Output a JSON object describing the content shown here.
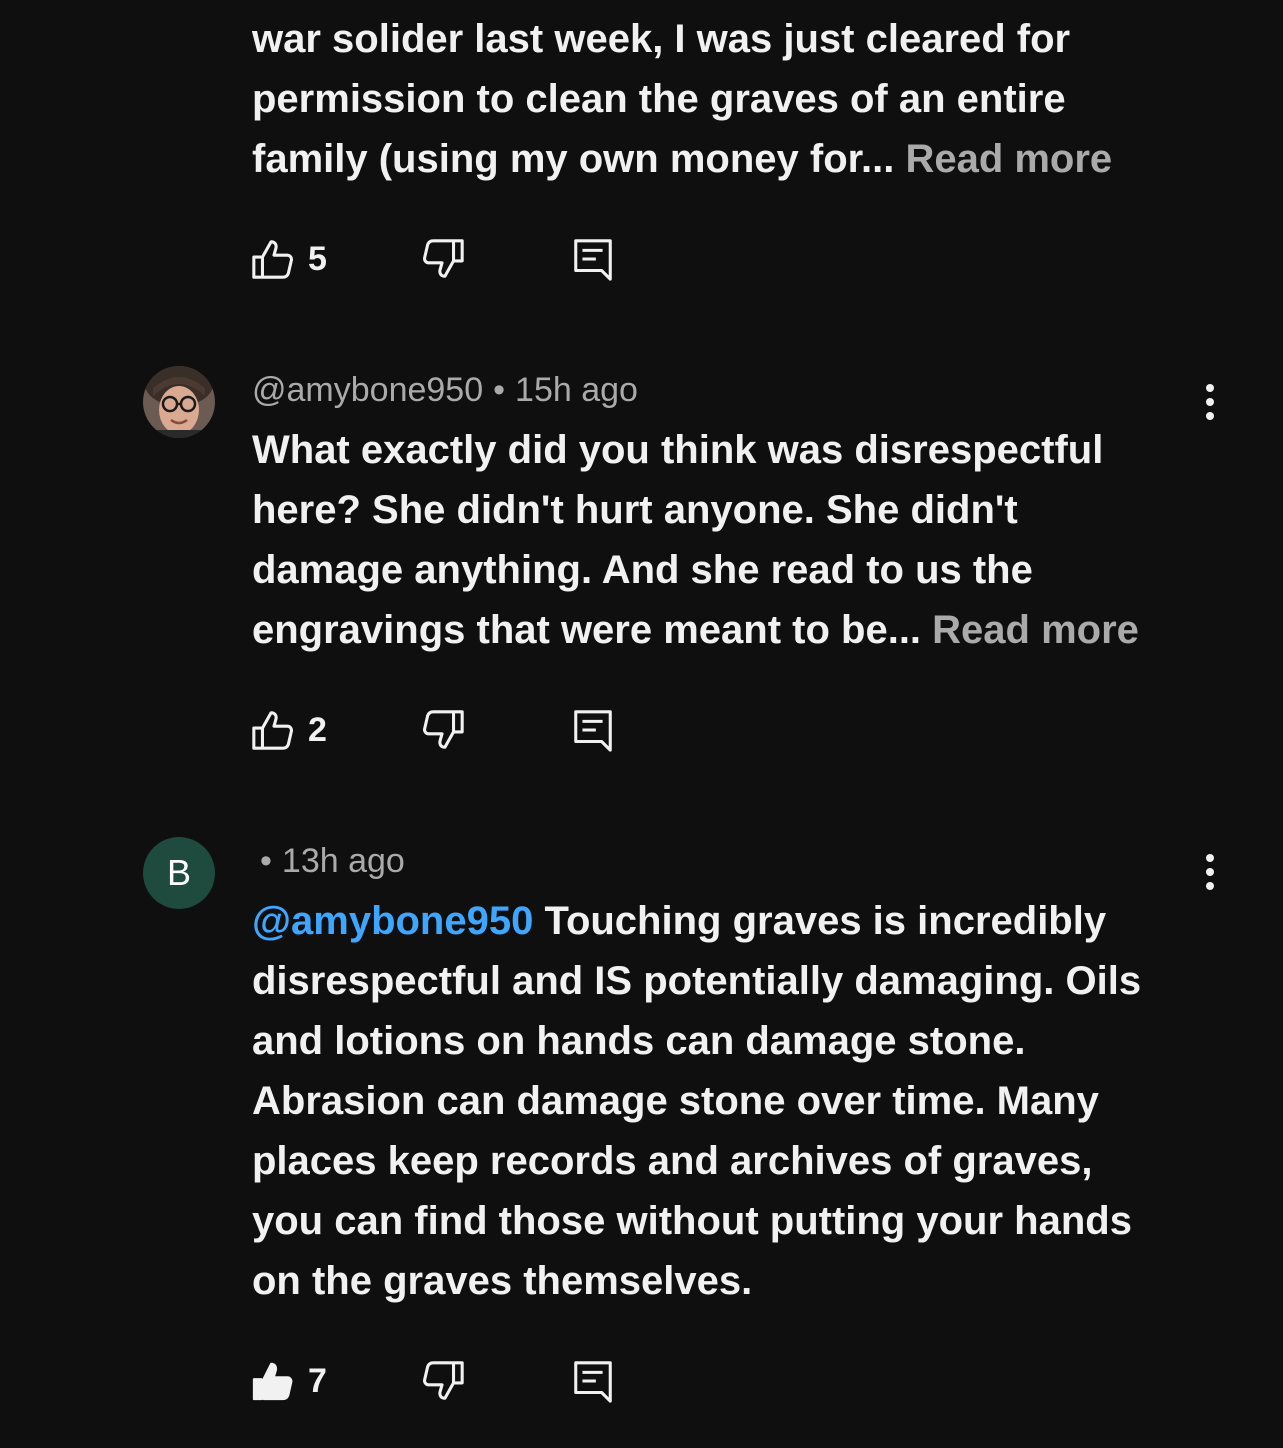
{
  "colors": {
    "background": "#0f0f0f",
    "text": "#f1f1f1",
    "muted": "#aaaaaa",
    "mention": "#3ea6ff",
    "avatar_b_bg": "#1f4a3e"
  },
  "comments": [
    {
      "body_lines": [
        "war solider last week, I was just cleared for",
        "permission to clean the graves of an entire",
        "family (using my own money for... "
      ],
      "read_more": "Read more",
      "likes": "5",
      "liked": false,
      "icons": [
        "thumb-up-icon",
        "thumb-down-icon",
        "reply-icon"
      ]
    },
    {
      "avatar": "photo-avatar",
      "handle": "@amybone950",
      "separator": "•",
      "time": "15h ago",
      "body_lines": [
        "What exactly did you think was disrespectful",
        "here? She didn't hurt anyone. She didn't",
        "damage anything. And she read to us the",
        "engravings that were meant to be... "
      ],
      "read_more": "Read more",
      "likes": "2",
      "liked": false,
      "icons": [
        "more-vert-icon",
        "thumb-up-icon",
        "thumb-down-icon",
        "reply-icon"
      ]
    },
    {
      "avatar_letter": "B",
      "separator": "•",
      "time": "13h ago",
      "mention": "@amybone950",
      "body_first": " Touching graves is incredibly",
      "body_lines": [
        "disrespectful and IS potentially damaging. Oils",
        "and lotions on hands can damage stone.",
        "Abrasion can damage stone over time. Many",
        "places keep records and archives of graves,",
        "you can find those without putting your hands",
        "on the graves themselves."
      ],
      "likes": "7",
      "liked": true,
      "icons": [
        "more-vert-icon",
        "thumb-up-filled-icon",
        "thumb-down-icon",
        "reply-icon"
      ]
    }
  ]
}
